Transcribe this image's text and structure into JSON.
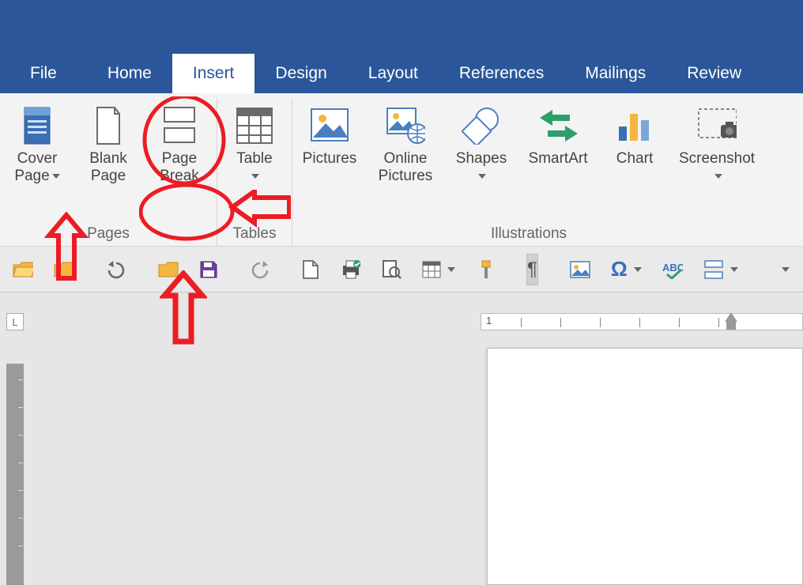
{
  "tabs": {
    "file": "File",
    "home": "Home",
    "insert": "Insert",
    "design": "Design",
    "layout": "Layout",
    "references": "References",
    "mailings": "Mailings",
    "review": "Review"
  },
  "ribbon": {
    "pages": {
      "label": "Pages",
      "cover": "Cover\nPage",
      "blank": "Blank\nPage",
      "break": "Page\nBreak"
    },
    "tables": {
      "label": "Tables",
      "table": "Table"
    },
    "illustrations": {
      "label": "Illustrations",
      "pictures": "Pictures",
      "online": "Online\nPictures",
      "shapes": "Shapes",
      "smartart": "SmartArt",
      "chart": "Chart",
      "screenshot": "Screenshot"
    }
  },
  "ruler": {
    "corner": "L",
    "number": "1"
  },
  "colors": {
    "accent": "#2b579a",
    "annotation": "#ec1c24"
  }
}
